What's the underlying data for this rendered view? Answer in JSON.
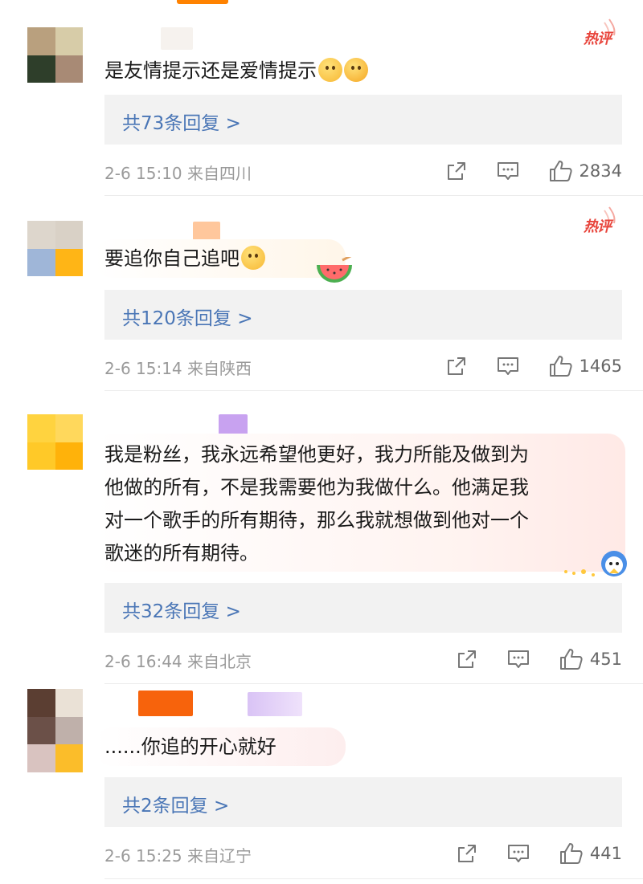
{
  "hot_label": "热评",
  "comments": [
    {
      "text": "是友情提示还是爱情提示",
      "reply_label": "共73条回复 >",
      "date": "2-6 15:10",
      "location": "来自四川",
      "likes": "2834",
      "avatar_colors": [
        "#b9a07e",
        "#d7cca8",
        "#2e3e2a",
        "#a88a75"
      ],
      "hot": true
    },
    {
      "text": "要追你自己追吧",
      "reply_label": "共120条回复 >",
      "date": "2-6 15:14",
      "location": "来自陕西",
      "likes": "1465",
      "avatar_colors": [
        "#ddd6cc",
        "#d9d1c6",
        "#9fb6d8",
        "#ffb516"
      ],
      "hot": true
    },
    {
      "text_lines": [
        "我是粉丝，我永远希望他更好，我力所能及做到为",
        "他做的所有，不是我需要他为我做什么。他满足我",
        "对一个歌手的所有期待，那么我就想做到他对一个",
        "歌迷的所有期待。"
      ],
      "reply_label": "共32条回复 >",
      "date": "2-6 16:44",
      "location": "来自北京",
      "likes": "451",
      "avatar_colors": [
        "#ffd33f",
        "#ffd85c",
        "#ffc928",
        "#ffb20a"
      ],
      "hot": false
    },
    {
      "text": "......你追的开心就好",
      "reply_label": "共2条回复 >",
      "date": "2-6 15:25",
      "location": "来自辽宁",
      "likes": "441",
      "avatar_colors": [
        "#5b3e32",
        "#eae1d6",
        "#6b5048",
        "#bfb0aa",
        "#d9c3c0",
        "#fbbd2a"
      ],
      "hot": false
    }
  ],
  "colors": {
    "accent": "#ff8200",
    "link": "#4a76b6",
    "hot": "#e8453c",
    "meta": "#9a9a9a"
  },
  "icons": [
    "share-icon",
    "comment-icon",
    "like-icon"
  ]
}
